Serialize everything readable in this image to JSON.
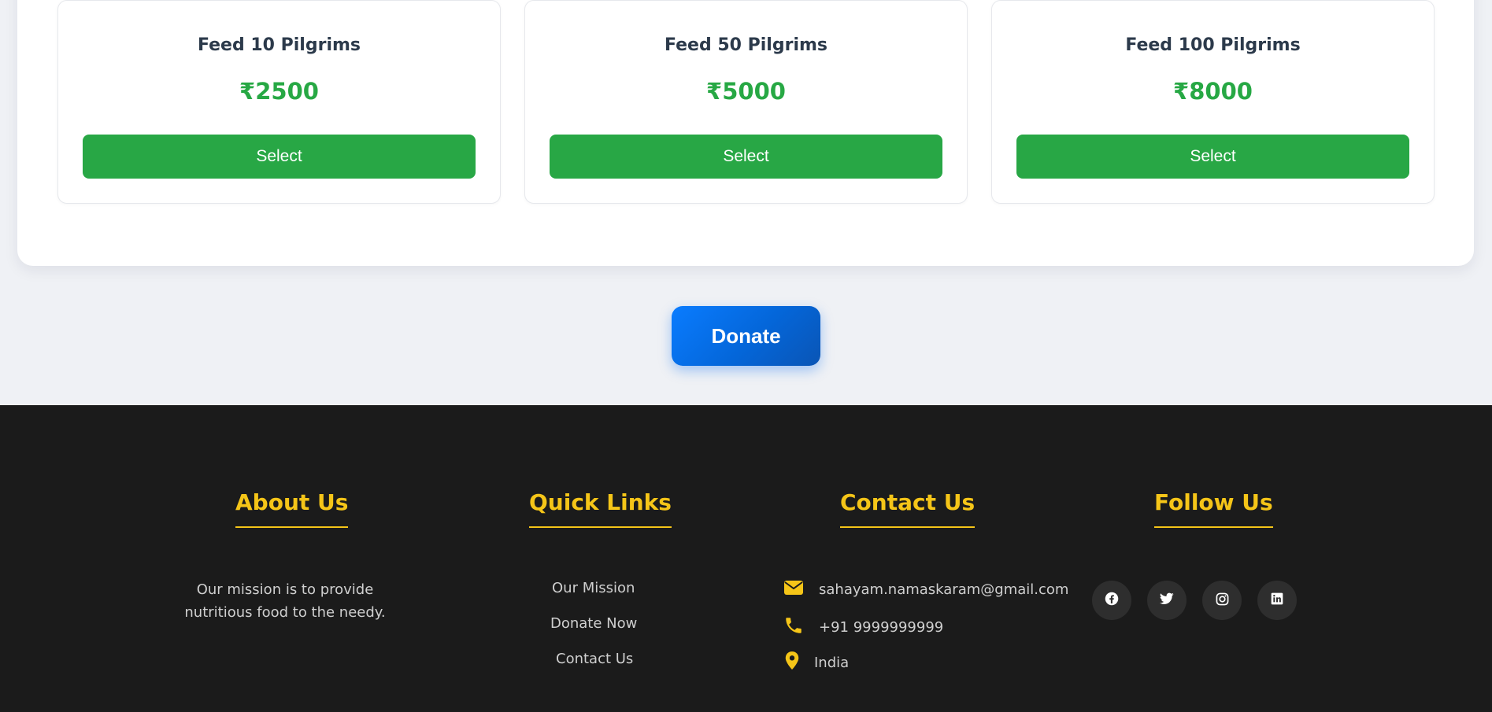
{
  "packages": [
    {
      "title": "Feed 10 Pilgrims",
      "price": "₹2500",
      "button": "Select"
    },
    {
      "title": "Feed 50 Pilgrims",
      "price": "₹5000",
      "button": "Select"
    },
    {
      "title": "Feed 100 Pilgrims",
      "price": "₹8000",
      "button": "Select"
    }
  ],
  "donate_label": "Donate",
  "footer": {
    "about": {
      "heading": "About Us",
      "text": "Our mission is to provide nutritious food to the needy."
    },
    "quick_links": {
      "heading": "Quick Links",
      "links": [
        "Our Mission",
        "Donate Now",
        "Contact Us"
      ]
    },
    "contact": {
      "heading": "Contact Us",
      "email": "sahayam.namaskaram@gmail.com",
      "phone": "+91 9999999999",
      "location": "India"
    },
    "follow": {
      "heading": "Follow Us",
      "icons": [
        "facebook-icon",
        "twitter-icon",
        "instagram-icon",
        "linkedin-icon"
      ]
    }
  },
  "colors": {
    "green": "#28a745",
    "blue": "#0a7cff",
    "accent_yellow": "#f5c518",
    "footer_bg": "#1b1b1b"
  }
}
